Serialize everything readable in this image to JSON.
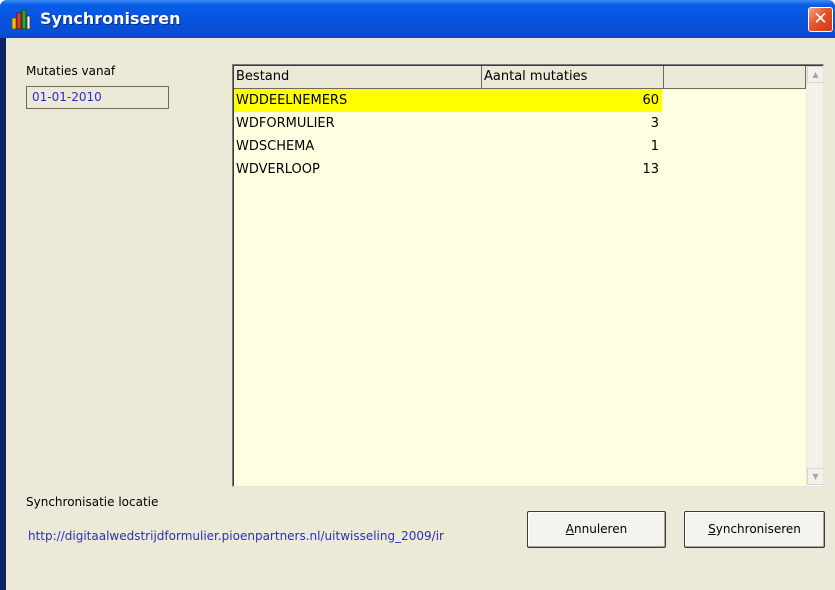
{
  "window": {
    "title": "Synchroniseren",
    "close_symbol": "✕",
    "icon": "app-chart-icon"
  },
  "form": {
    "mutaties_label": "Mutaties vanaf",
    "mutaties_value": "01-01-2010",
    "sync_location_label": "Synchronisatie locatie",
    "sync_location_value": "http://digitaalwedstrijdformulier.pioenpartners.nl/uitwisseling_2009/ir"
  },
  "table": {
    "columns": [
      "Bestand",
      "Aantal mutaties",
      ""
    ],
    "rows": [
      {
        "bestand": "WDDEELNEMERS",
        "aantal": "60",
        "selected": true
      },
      {
        "bestand": "WDFORMULIER",
        "aantal": "3",
        "selected": false
      },
      {
        "bestand": "WDSCHEMA",
        "aantal": "1",
        "selected": false
      },
      {
        "bestand": "WDVERLOOP",
        "aantal": "13",
        "selected": false
      }
    ]
  },
  "buttons": {
    "annuleren": {
      "mnemonic": "A",
      "rest": "nnuleren"
    },
    "synchroniseren": {
      "mnemonic": "S",
      "rest": "ynchroniseren"
    }
  },
  "colors": {
    "selection": "#ffff00",
    "list_bg": "#fffee1",
    "value_text": "#2b2ec4",
    "titlebar": "#0553e0"
  }
}
